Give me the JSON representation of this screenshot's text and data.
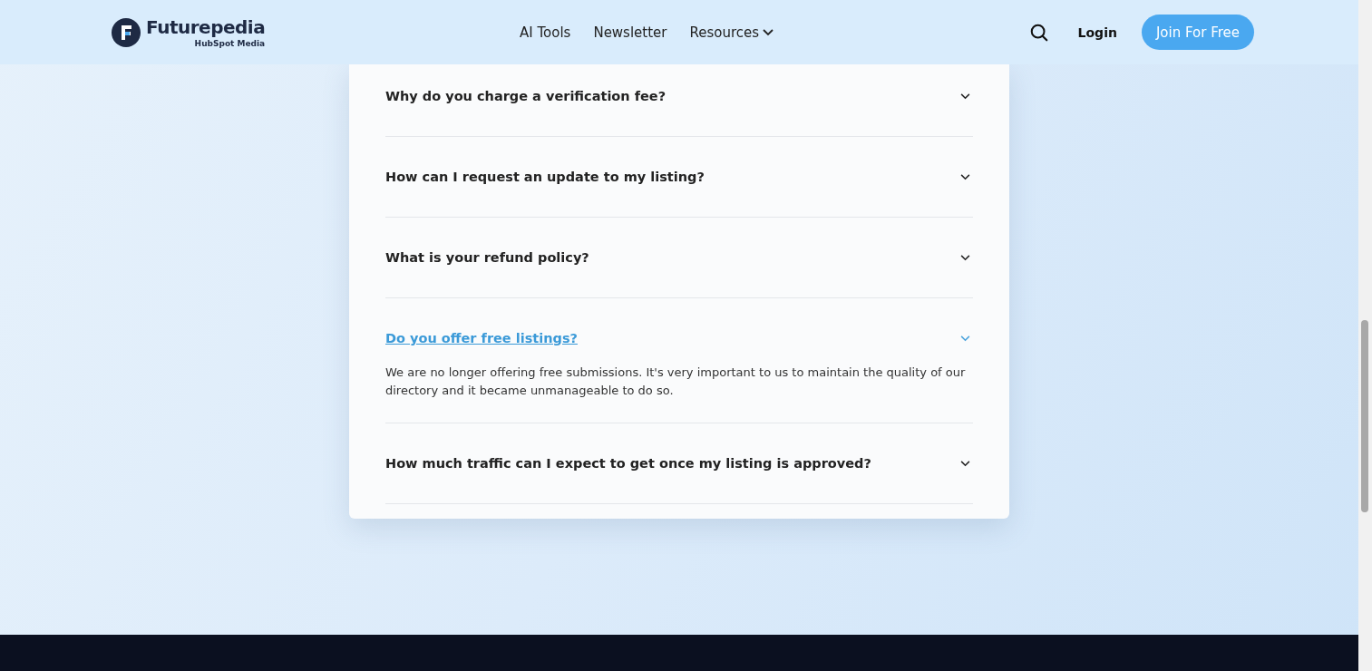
{
  "header": {
    "logo": {
      "name": "Futurepedia",
      "tagline": "HubSpot Media"
    },
    "nav": [
      {
        "label": "AI Tools",
        "dropdown": false
      },
      {
        "label": "Newsletter",
        "dropdown": false
      },
      {
        "label": "Resources",
        "dropdown": true
      }
    ],
    "login": "Login",
    "cta": "Join For Free"
  },
  "faq": [
    {
      "question": "Why do you charge a verification fee?",
      "expanded": false
    },
    {
      "question": "How can I request an update to my listing?",
      "expanded": false
    },
    {
      "question": "What is your refund policy?",
      "expanded": false
    },
    {
      "question": "Do you offer free listings?",
      "expanded": true,
      "answer": "We are no longer offering free submissions. It's very important to us to maintain the quality of our directory and it became unmanageable to do so."
    },
    {
      "question": "How much traffic can I expect to get once my listing is approved?",
      "expanded": false
    }
  ]
}
